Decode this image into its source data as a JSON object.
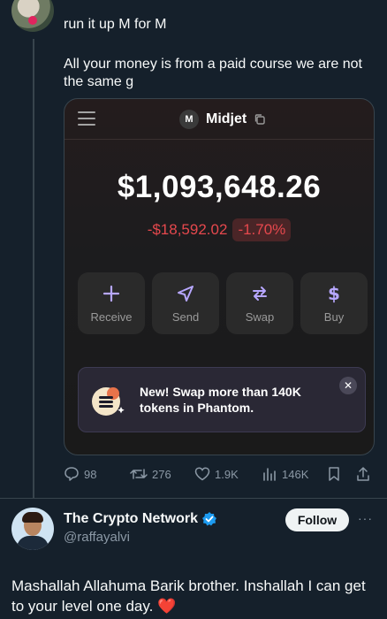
{
  "top_post": {
    "reply_line": "run it up M for M",
    "text": "All your money is from a paid course we are not the same g"
  },
  "wallet": {
    "account_badge": "M",
    "account_name": "Midjet",
    "balance": "$1,093,648.26",
    "change_amount": "-$18,592.02",
    "change_percent": "-1.70%",
    "actions": [
      {
        "label": "Receive",
        "icon": "plus-icon"
      },
      {
        "label": "Send",
        "icon": "send-icon"
      },
      {
        "label": "Swap",
        "icon": "swap-icon"
      },
      {
        "label": "Buy",
        "icon": "dollar-icon"
      }
    ],
    "banner_text": "New! Swap more than 140K tokens in Phantom.",
    "banner_close": "✕",
    "colors": {
      "negative": "#e5484d",
      "action_icon": "#b7a7ff"
    }
  },
  "metrics": {
    "replies": "98",
    "retweets": "276",
    "likes": "1.9K",
    "views": "146K"
  },
  "reply_post": {
    "name": "The Crypto Network",
    "handle": "@raffayalvi",
    "follow_label": "Follow",
    "more": "···",
    "text": "Mashallah Allahuma Barik brother. Inshallah I can get to your level one day. ❤️"
  }
}
